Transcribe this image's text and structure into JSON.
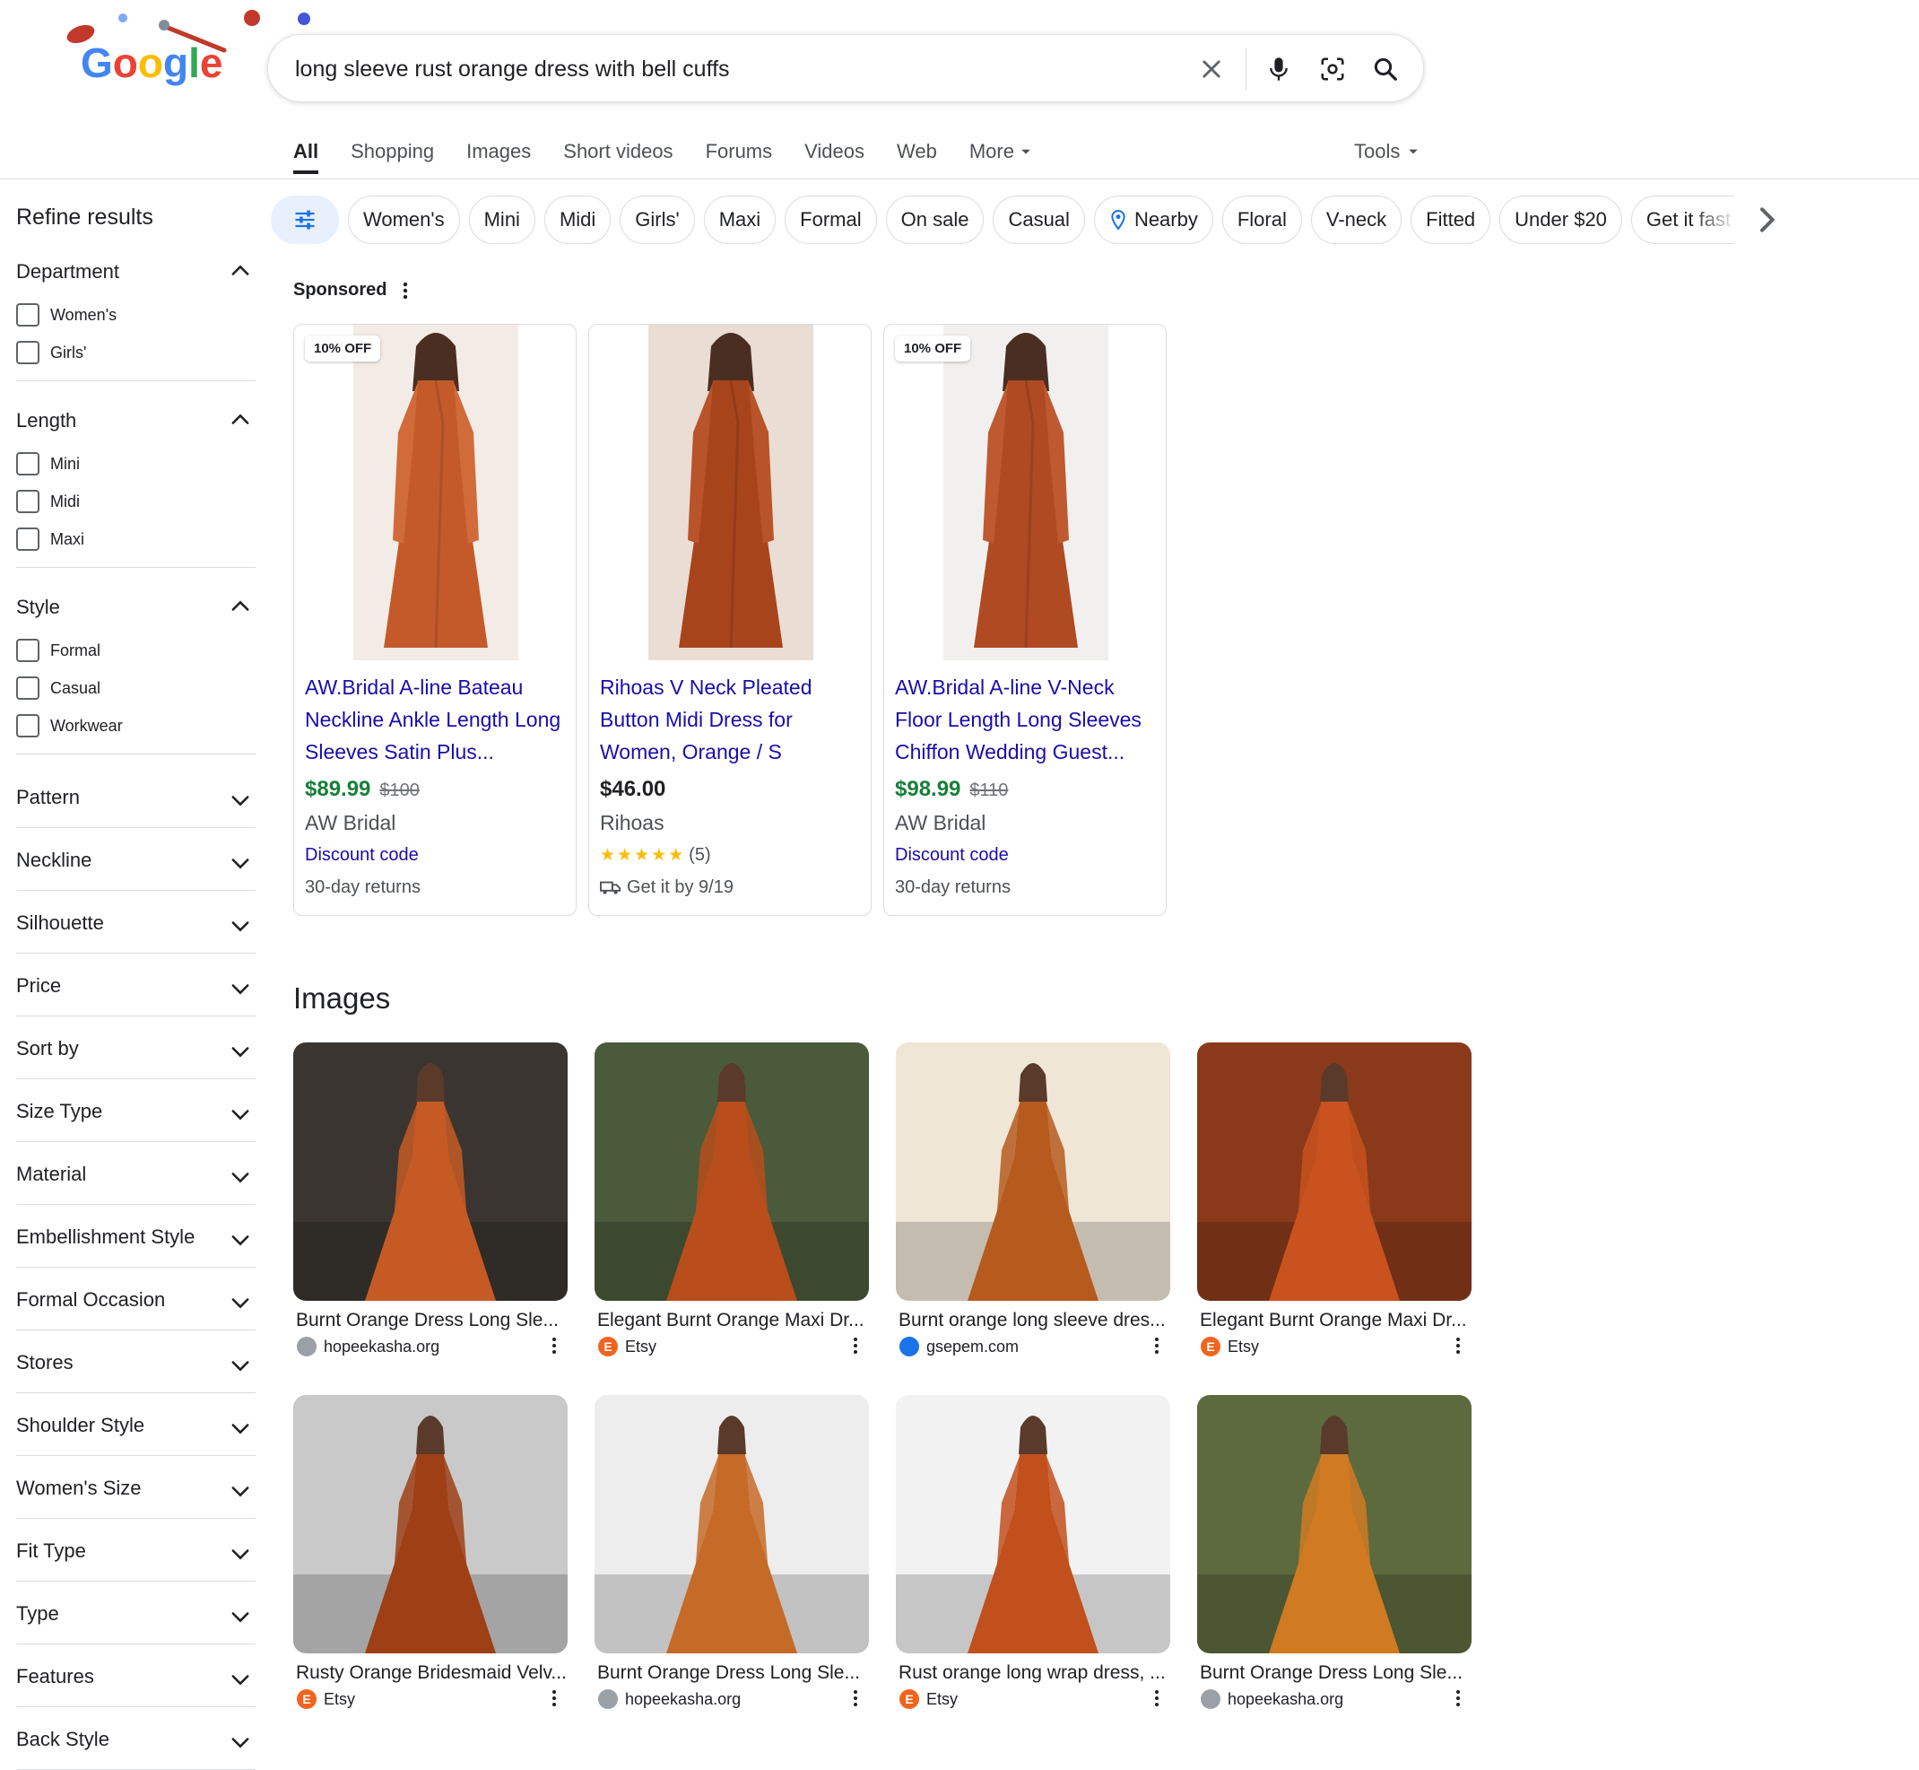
{
  "search": {
    "query": "long sleeve rust orange dress with bell cuffs"
  },
  "nav": {
    "tabs": [
      "All",
      "Shopping",
      "Images",
      "Short videos",
      "Forums",
      "Videos",
      "Web",
      "More"
    ],
    "tools": "Tools"
  },
  "sidebar": {
    "title": "Refine results",
    "department": {
      "title": "Department",
      "options": [
        "Women's",
        "Girls'"
      ]
    },
    "length": {
      "title": "Length",
      "options": [
        "Mini",
        "Midi",
        "Maxi"
      ]
    },
    "style": {
      "title": "Style",
      "options": [
        "Formal",
        "Casual",
        "Workwear"
      ]
    },
    "collapsed": [
      "Pattern",
      "Neckline",
      "Silhouette",
      "Price",
      "Sort by",
      "Size Type",
      "Material",
      "Embellishment Style",
      "Formal Occasion",
      "Stores",
      "Shoulder Style",
      "Women's Size",
      "Fit Type",
      "Type",
      "Features",
      "Back Style"
    ]
  },
  "chips": [
    "Women's",
    "Mini",
    "Midi",
    "Girls'",
    "Maxi",
    "Formal",
    "On sale",
    "Casual",
    "Nearby",
    "Floral",
    "V-neck",
    "Fitted",
    "Under $20",
    "Get it fast"
  ],
  "sponsored": {
    "label": "Sponsored",
    "products": [
      {
        "badge": "10% OFF",
        "title": "AW.Bridal A-line Bateau Neckline Ankle Length Long Sleeves Satin Plus...",
        "price": "$89.99",
        "was": "$100",
        "merchant": "AW Bridal",
        "link": "Discount code",
        "note": "30-day returns"
      },
      {
        "badge": "",
        "title": "Rihoas V Neck Pleated Button Midi Dress for Women, Orange / S",
        "price": "$46.00",
        "was": "",
        "merchant": "Rihoas",
        "stars": "★★★★★",
        "rating_count": "(5)",
        "note": "Get it by 9/19"
      },
      {
        "badge": "10% OFF",
        "title": "AW.Bridal A-line V-Neck Floor Length Long Sleeves Chiffon Wedding Guest...",
        "price": "$98.99",
        "was": "$110",
        "merchant": "AW Bridal",
        "link": "Discount code",
        "note": "30-day returns"
      }
    ]
  },
  "images": {
    "title": "Images",
    "items": [
      {
        "caption": "Burnt Orange Dress Long Sle...",
        "source": "hopeekasha.org",
        "fav": "",
        "favColor": "#9aa0a6",
        "bg": "#3a3530",
        "dress": "#c65a24"
      },
      {
        "caption": "Elegant Burnt Orange Maxi Dr...",
        "source": "Etsy",
        "fav": "E",
        "favColor": "#f1641e",
        "bg": "#4a5a3a",
        "dress": "#b94d1c"
      },
      {
        "caption": "Burnt orange long sleeve dres...",
        "source": "gsepem.com",
        "fav": "",
        "favColor": "#1a73e8",
        "bg": "#efe6d6",
        "dress": "#b65a1e"
      },
      {
        "caption": "Elegant Burnt Orange Maxi Dr...",
        "source": "Etsy",
        "fav": "E",
        "favColor": "#f1641e",
        "bg": "#8a3a1a",
        "dress": "#c9521e"
      },
      {
        "caption": "Rusty Orange Bridesmaid Velv...",
        "source": "Etsy",
        "fav": "E",
        "favColor": "#f1641e",
        "bg": "#c9c9c9",
        "dress": "#9e3f16"
      },
      {
        "caption": "Burnt Orange Dress Long Sle...",
        "source": "hopeekasha.org",
        "fav": "",
        "favColor": "#9aa0a6",
        "bg": "#ededed",
        "dress": "#c66a28"
      },
      {
        "caption": "Rust orange long wrap dress, ...",
        "source": "Etsy",
        "fav": "E",
        "favColor": "#f1641e",
        "bg": "#f2f2f2",
        "dress": "#c2501c"
      },
      {
        "caption": "Burnt Orange Dress Long Sle...",
        "source": "hopeekasha.org",
        "fav": "",
        "favColor": "#9aa0a6",
        "bg": "#5d6a3e",
        "dress": "#d07a22"
      }
    ]
  }
}
